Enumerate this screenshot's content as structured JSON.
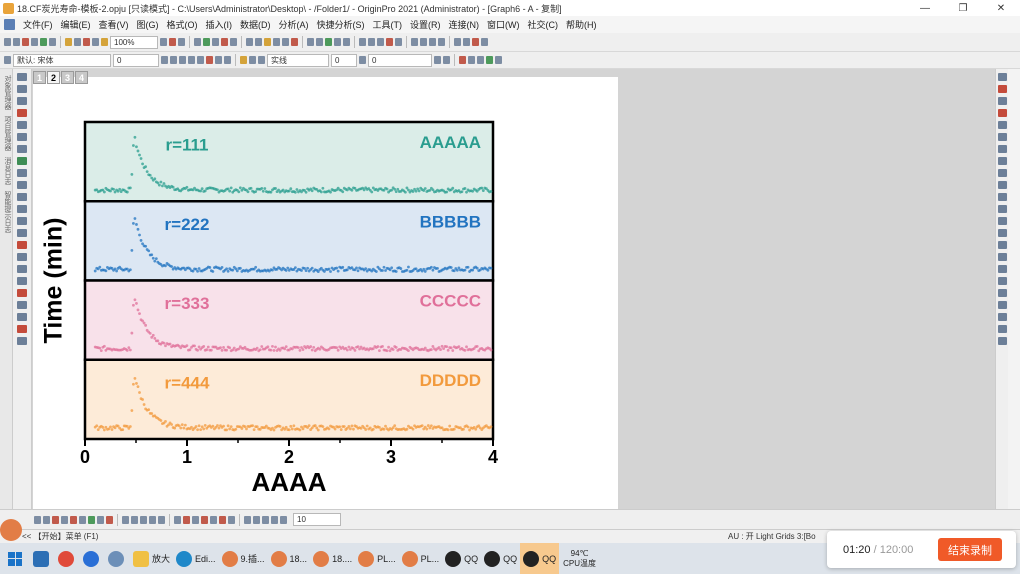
{
  "titlebar": {
    "title": "18.CF炭光寿命-模板-2.opju [只读模式] - C:\\Users\\Administrator\\Desktop\\ - /Folder1/ - OriginPro 2021 (Administrator) - [Graph6 - A - 复制]",
    "minimize": "—",
    "restore": "❐",
    "close": "✕"
  },
  "menubar": {
    "items": [
      "文件(F)",
      "编辑(E)",
      "查看(V)",
      "图(G)",
      "格式(O)",
      "插入(I)",
      "数据(D)",
      "分析(A)",
      "快捷分析(S)",
      "工具(T)",
      "设置(R)",
      "连接(N)",
      "窗口(W)",
      "社交(C)",
      "帮助(H)"
    ]
  },
  "toolbar": {
    "zoom": "100%",
    "font_name": "默认: 宋体",
    "font_size": "0",
    "line_style": "实线",
    "line_width": "0",
    "color_value": "0",
    "bottom_size": "10"
  },
  "left_panel_labels": [
    "对象管理器",
    "项目管理器",
    "消息日志",
    "智能提示日志"
  ],
  "layer_tabs": [
    "1",
    "2",
    "3",
    "4"
  ],
  "chart_data": {
    "type": "scatter",
    "xlabel": "AAAA",
    "ylabel": "Time (min)",
    "xlim": [
      0,
      4
    ],
    "x_ticks": [
      "0",
      "1",
      "2",
      "3",
      "4"
    ],
    "panels": [
      {
        "name": "AAAAA",
        "annotation": "r=111",
        "color": "#2a9d8f",
        "bg": "#dbede8"
      },
      {
        "name": "BBBBB",
        "annotation": "r=222",
        "color": "#2274c0",
        "bg": "#dce7f3"
      },
      {
        "name": "CCCCC",
        "annotation": "r=333",
        "color": "#e0709a",
        "bg": "#f8e1ea"
      },
      {
        "name": "DDDDD",
        "annotation": "r=444",
        "color": "#f29a3d",
        "bg": "#fdebd8"
      }
    ],
    "decay": {
      "onset": 0.45,
      "peak": 0.48,
      "baseline": 0.08,
      "peak_level": 0.92,
      "tau": 0.12
    }
  },
  "statusbar": {
    "left": "<<  【开始】菜单 (F1)",
    "right": "AU : 开  Light Grids 3:[Bo"
  },
  "taskbar": {
    "items": [
      "放大",
      "Edi...",
      "9.插...",
      "18...",
      "18....",
      "PL...",
      "PL...",
      "QQ",
      "QQ",
      "QQ"
    ],
    "cpu_temp": "94℃",
    "cpu_label": "CPU温度"
  },
  "recorder": {
    "elapsed": "01:20",
    "total": "/ 120:00",
    "stop_label": "结束录制"
  }
}
